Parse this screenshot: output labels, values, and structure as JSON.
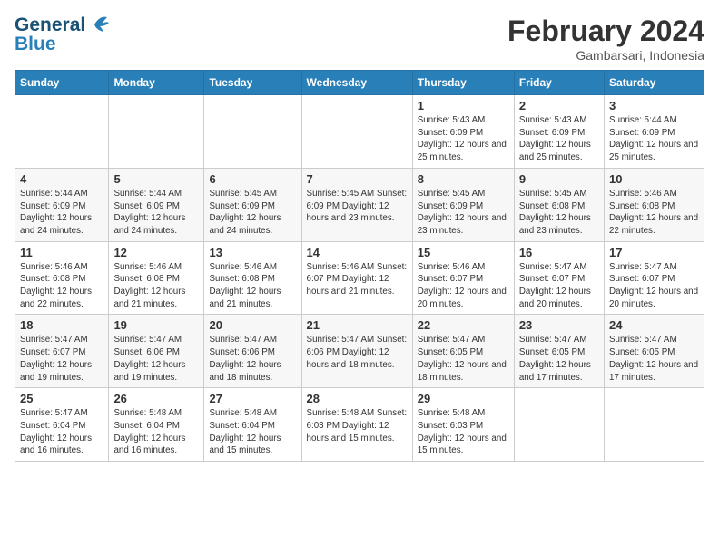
{
  "header": {
    "logo_line1": "General",
    "logo_line2": "Blue",
    "main_title": "February 2024",
    "sub_title": "Gambarsari, Indonesia"
  },
  "days_of_week": [
    "Sunday",
    "Monday",
    "Tuesday",
    "Wednesday",
    "Thursday",
    "Friday",
    "Saturday"
  ],
  "weeks": [
    [
      {
        "day": "",
        "info": ""
      },
      {
        "day": "",
        "info": ""
      },
      {
        "day": "",
        "info": ""
      },
      {
        "day": "",
        "info": ""
      },
      {
        "day": "1",
        "info": "Sunrise: 5:43 AM\nSunset: 6:09 PM\nDaylight: 12 hours\nand 25 minutes."
      },
      {
        "day": "2",
        "info": "Sunrise: 5:43 AM\nSunset: 6:09 PM\nDaylight: 12 hours\nand 25 minutes."
      },
      {
        "day": "3",
        "info": "Sunrise: 5:44 AM\nSunset: 6:09 PM\nDaylight: 12 hours\nand 25 minutes."
      }
    ],
    [
      {
        "day": "4",
        "info": "Sunrise: 5:44 AM\nSunset: 6:09 PM\nDaylight: 12 hours\nand 24 minutes."
      },
      {
        "day": "5",
        "info": "Sunrise: 5:44 AM\nSunset: 6:09 PM\nDaylight: 12 hours\nand 24 minutes."
      },
      {
        "day": "6",
        "info": "Sunrise: 5:45 AM\nSunset: 6:09 PM\nDaylight: 12 hours\nand 24 minutes."
      },
      {
        "day": "7",
        "info": "Sunrise: 5:45 AM\nSunset: 6:09 PM\nDaylight: 12 hours\nand 23 minutes."
      },
      {
        "day": "8",
        "info": "Sunrise: 5:45 AM\nSunset: 6:09 PM\nDaylight: 12 hours\nand 23 minutes."
      },
      {
        "day": "9",
        "info": "Sunrise: 5:45 AM\nSunset: 6:08 PM\nDaylight: 12 hours\nand 23 minutes."
      },
      {
        "day": "10",
        "info": "Sunrise: 5:46 AM\nSunset: 6:08 PM\nDaylight: 12 hours\nand 22 minutes."
      }
    ],
    [
      {
        "day": "11",
        "info": "Sunrise: 5:46 AM\nSunset: 6:08 PM\nDaylight: 12 hours\nand 22 minutes."
      },
      {
        "day": "12",
        "info": "Sunrise: 5:46 AM\nSunset: 6:08 PM\nDaylight: 12 hours\nand 21 minutes."
      },
      {
        "day": "13",
        "info": "Sunrise: 5:46 AM\nSunset: 6:08 PM\nDaylight: 12 hours\nand 21 minutes."
      },
      {
        "day": "14",
        "info": "Sunrise: 5:46 AM\nSunset: 6:07 PM\nDaylight: 12 hours\nand 21 minutes."
      },
      {
        "day": "15",
        "info": "Sunrise: 5:46 AM\nSunset: 6:07 PM\nDaylight: 12 hours\nand 20 minutes."
      },
      {
        "day": "16",
        "info": "Sunrise: 5:47 AM\nSunset: 6:07 PM\nDaylight: 12 hours\nand 20 minutes."
      },
      {
        "day": "17",
        "info": "Sunrise: 5:47 AM\nSunset: 6:07 PM\nDaylight: 12 hours\nand 20 minutes."
      }
    ],
    [
      {
        "day": "18",
        "info": "Sunrise: 5:47 AM\nSunset: 6:07 PM\nDaylight: 12 hours\nand 19 minutes."
      },
      {
        "day": "19",
        "info": "Sunrise: 5:47 AM\nSunset: 6:06 PM\nDaylight: 12 hours\nand 19 minutes."
      },
      {
        "day": "20",
        "info": "Sunrise: 5:47 AM\nSunset: 6:06 PM\nDaylight: 12 hours\nand 18 minutes."
      },
      {
        "day": "21",
        "info": "Sunrise: 5:47 AM\nSunset: 6:06 PM\nDaylight: 12 hours\nand 18 minutes."
      },
      {
        "day": "22",
        "info": "Sunrise: 5:47 AM\nSunset: 6:05 PM\nDaylight: 12 hours\nand 18 minutes."
      },
      {
        "day": "23",
        "info": "Sunrise: 5:47 AM\nSunset: 6:05 PM\nDaylight: 12 hours\nand 17 minutes."
      },
      {
        "day": "24",
        "info": "Sunrise: 5:47 AM\nSunset: 6:05 PM\nDaylight: 12 hours\nand 17 minutes."
      }
    ],
    [
      {
        "day": "25",
        "info": "Sunrise: 5:47 AM\nSunset: 6:04 PM\nDaylight: 12 hours\nand 16 minutes."
      },
      {
        "day": "26",
        "info": "Sunrise: 5:48 AM\nSunset: 6:04 PM\nDaylight: 12 hours\nand 16 minutes."
      },
      {
        "day": "27",
        "info": "Sunrise: 5:48 AM\nSunset: 6:04 PM\nDaylight: 12 hours\nand 15 minutes."
      },
      {
        "day": "28",
        "info": "Sunrise: 5:48 AM\nSunset: 6:03 PM\nDaylight: 12 hours\nand 15 minutes."
      },
      {
        "day": "29",
        "info": "Sunrise: 5:48 AM\nSunset: 6:03 PM\nDaylight: 12 hours\nand 15 minutes."
      },
      {
        "day": "",
        "info": ""
      },
      {
        "day": "",
        "info": ""
      }
    ]
  ]
}
